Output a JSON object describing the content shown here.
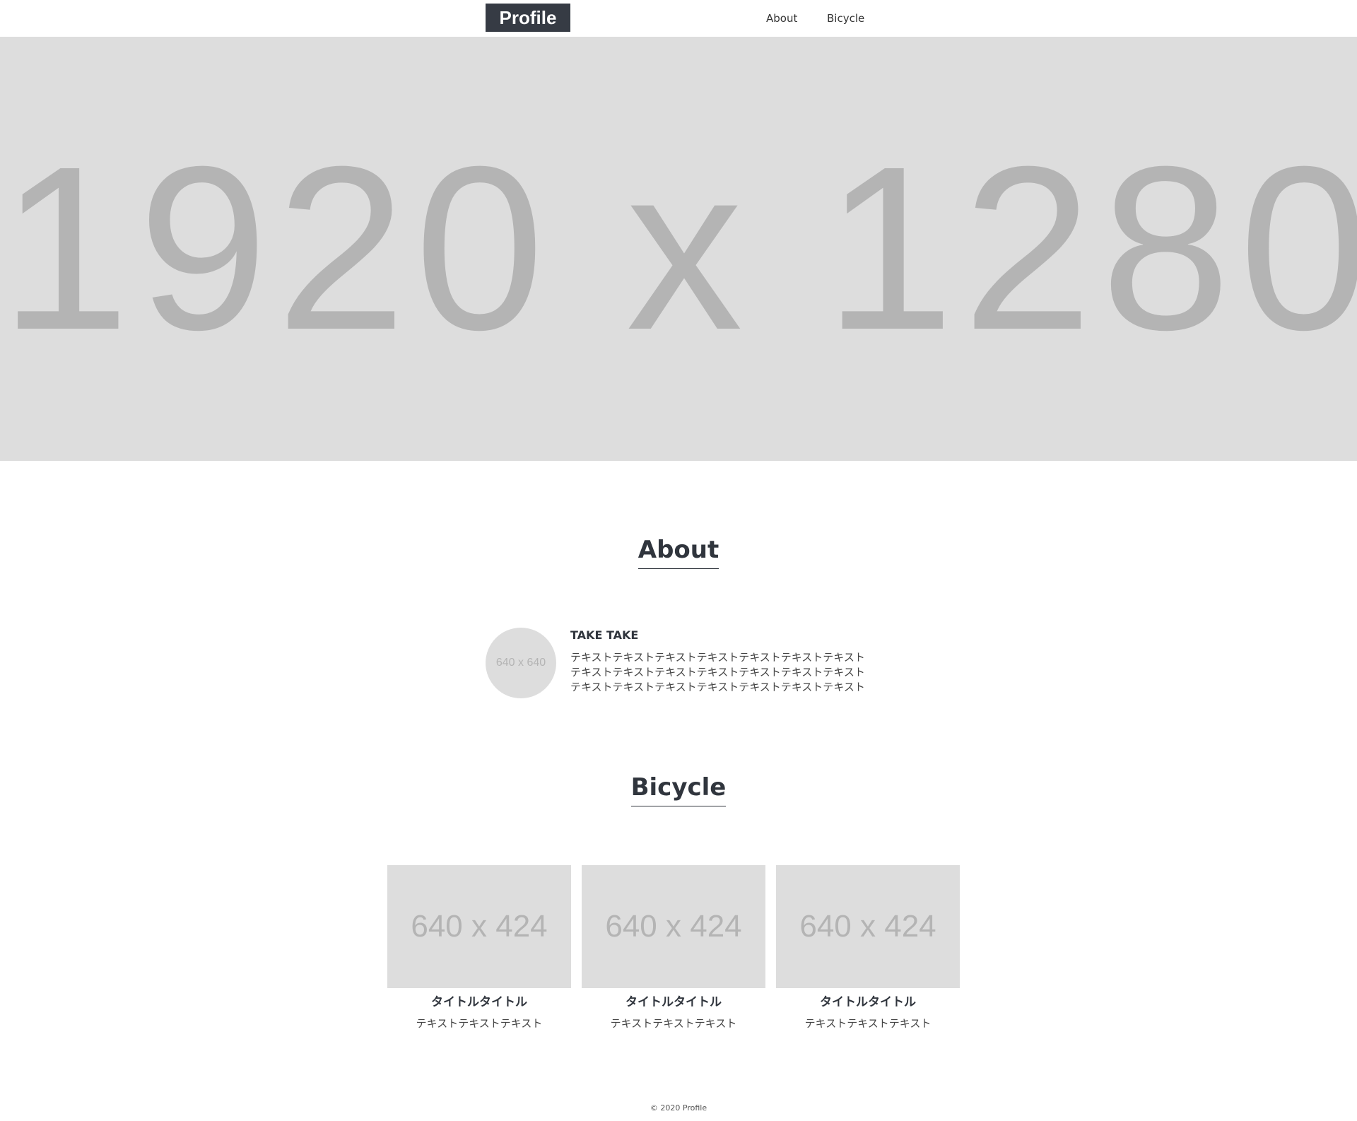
{
  "header": {
    "logo": "Profile",
    "nav": [
      {
        "label": "About"
      },
      {
        "label": "Bicycle"
      }
    ]
  },
  "hero": {
    "placeholder_text": "1920 x 1280"
  },
  "about": {
    "title": "About",
    "avatar_placeholder": "640 x 640",
    "name": "TAKE TAKE",
    "text_lines": [
      "テキストテキストテキストテキストテキストテキストテキスト",
      "テキストテキストテキストテキストテキストテキストテキスト",
      "テキストテキストテキストテキストテキストテキストテキスト"
    ]
  },
  "bicycle": {
    "title": "Bicycle",
    "cards": [
      {
        "image_placeholder": "640 x 424",
        "title": "タイトルタイトル",
        "text": "テキストテキストテキスト"
      },
      {
        "image_placeholder": "640 x 424",
        "title": "タイトルタイトル",
        "text": "テキストテキストテキスト"
      },
      {
        "image_placeholder": "640 x 424",
        "title": "タイトルタイトル",
        "text": "テキストテキストテキスト"
      }
    ]
  },
  "footer": {
    "copyright": "© 2020 Profile"
  },
  "colors": {
    "logo_bg": "#363b44",
    "placeholder_bg": "#dddddd",
    "placeholder_text": "#b4b4b4",
    "heading": "#30353d"
  }
}
